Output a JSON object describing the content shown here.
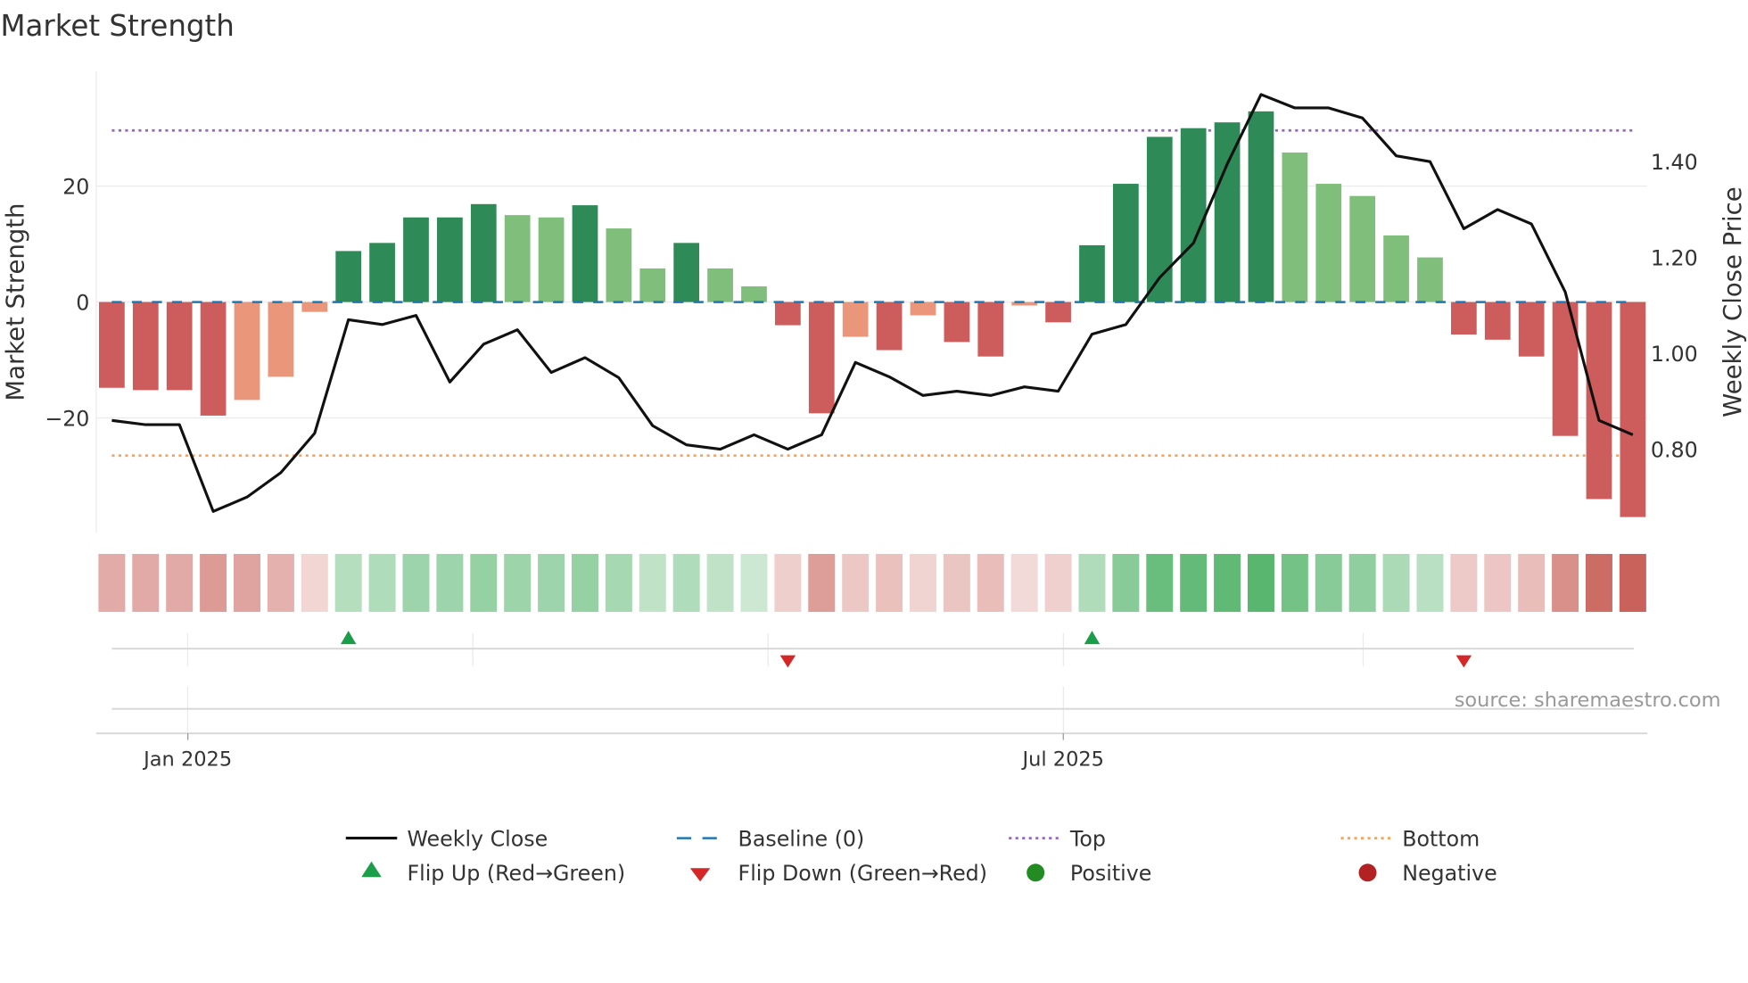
{
  "chart_data": {
    "type": "bar",
    "title": "Market Strength",
    "ylabel": "Market Strength",
    "y2label": "Weekly Close Price",
    "ylim": [
      -39,
      40
    ],
    "y2lim": [
      0.64,
      1.57
    ],
    "yticks": [
      -20,
      0,
      20
    ],
    "yticklabels": [
      "−20",
      "0",
      "20"
    ],
    "y2ticks": [
      0.8,
      1.0,
      1.2,
      1.4
    ],
    "y2ticklabels": [
      "0.80",
      "1.00",
      "1.20",
      "1.40"
    ],
    "xticklabels": [
      {
        "label": "Jan 2025",
        "index": 2.25
      },
      {
        "label": "Jul 2025",
        "index": 28.15
      }
    ],
    "grid": true,
    "legend_position": "bottom",
    "top_level": 29.6,
    "bottom_level": -26.5,
    "baseline": 0,
    "strength": [
      -14.8,
      -15.2,
      -15.2,
      -19.6,
      -16.9,
      -12.9,
      -1.7,
      8.8,
      10.2,
      14.6,
      14.6,
      16.9,
      15.0,
      14.6,
      16.7,
      12.7,
      5.8,
      10.2,
      5.8,
      2.7,
      -4.0,
      -19.2,
      -6.0,
      -8.3,
      -2.3,
      -6.9,
      -9.4,
      -0.6,
      -3.5,
      9.8,
      20.4,
      28.5,
      30.0,
      31.0,
      32.9,
      25.8,
      20.4,
      18.3,
      11.5,
      7.7,
      -5.6,
      -6.5,
      -9.4,
      -23.1,
      -34.0,
      -37.1
    ],
    "bar_tone": [
      "strong",
      "strong",
      "strong",
      "strong",
      "weak",
      "weak",
      "weak",
      "strong",
      "strong",
      "strong",
      "strong",
      "strong",
      "weak",
      "weak",
      "strong",
      "weak",
      "weak",
      "strong",
      "weak",
      "weak",
      "strong",
      "strong",
      "weak",
      "strong",
      "weak",
      "strong",
      "strong",
      "weak",
      "strong",
      "strong",
      "strong",
      "strong",
      "strong",
      "strong",
      "strong",
      "weak",
      "weak",
      "weak",
      "weak",
      "weak",
      "strong",
      "strong",
      "strong",
      "strong",
      "strong",
      "strong"
    ],
    "weekly_close": [
      0.86,
      0.851,
      0.851,
      0.67,
      0.7,
      0.751,
      0.833,
      1.07,
      1.06,
      1.079,
      0.94,
      1.019,
      1.049,
      0.96,
      0.991,
      0.949,
      0.849,
      0.809,
      0.8,
      0.83,
      0.8,
      0.83,
      0.981,
      0.951,
      0.912,
      0.921,
      0.912,
      0.93,
      0.921,
      1.04,
      1.06,
      1.158,
      1.23,
      1.395,
      1.54,
      1.512,
      1.512,
      1.491,
      1.412,
      1.4,
      1.26,
      1.3,
      1.27,
      1.128,
      0.86,
      0.83
    ],
    "flip_up_indices": [
      7,
      29
    ],
    "flip_down_indices": [
      20,
      40
    ],
    "legend": [
      {
        "label": "Weekly Close",
        "kind": "line"
      },
      {
        "label": "Baseline (0)",
        "kind": "dash"
      },
      {
        "label": "Top",
        "kind": "dot-purple"
      },
      {
        "label": "Bottom",
        "kind": "dot-orange"
      },
      {
        "label": "Flip Up (Red→Green)",
        "kind": "tri-up"
      },
      {
        "label": "Flip Down (Green→Red)",
        "kind": "tri-down"
      },
      {
        "label": "Positive",
        "kind": "dot-green"
      },
      {
        "label": "Negative",
        "kind": "dot-red"
      }
    ],
    "source": "source: sharemaestro.com"
  },
  "colors": {
    "pos_strong": "#2e8b57",
    "pos_weak": "#7fbf7b",
    "neg_strong": "#cd5c5c",
    "neg_weak": "#e9967a",
    "line": "#111111",
    "baseline": "#1f77b4",
    "top": "#9467bd",
    "bottom": "#f4a460",
    "flip_up": "#1a9e4a",
    "flip_down": "#d62728",
    "positive": "#228b22",
    "negative": "#b22222",
    "strip_pos": "#45ad5e",
    "strip_neg": "#c85f57"
  }
}
